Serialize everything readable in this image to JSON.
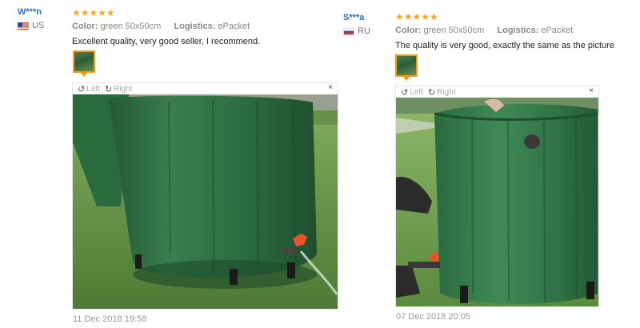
{
  "reviews": [
    {
      "username": "W***n",
      "country": "US",
      "stars": "★★★★★",
      "color_label": "Color:",
      "color_value": "green 50x50cm",
      "logistics_label": "Logistics:",
      "logistics_value": "ePacket",
      "text": "Excellent quality, very good seller, I recommend.",
      "viewer": {
        "left_label": "Left",
        "right_label": "Right",
        "close": "×"
      },
      "date": "11 Dec 2018 19:58"
    },
    {
      "username": "S***a",
      "country": "RU",
      "stars": "★★★★★",
      "color_label": "Color:",
      "color_value": "green 50x50cm",
      "logistics_label": "Logistics:",
      "logistics_value": "ePacket",
      "text": "The quality is very good, exactly the same as the picture",
      "viewer": {
        "left_label": "Left",
        "right_label": "Right",
        "close": "×"
      },
      "date": "07 Dec 2018 20:05"
    }
  ],
  "colors": {
    "accent": "#f39c12",
    "star": "#f5a623",
    "username": "#2a6ebb",
    "tank_green": "#2e6f42"
  }
}
